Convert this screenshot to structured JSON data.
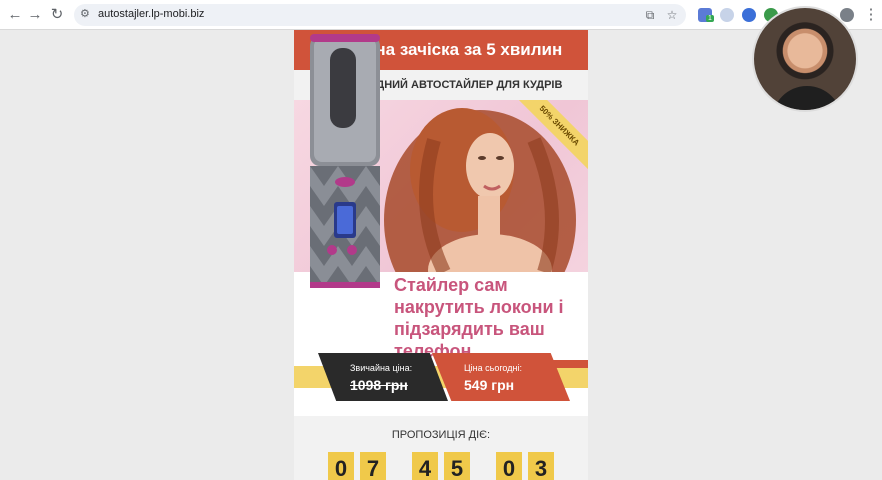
{
  "browser": {
    "url": "autostajler.lp-mobi.biz",
    "back_icon": "back-arrow-icon",
    "forward_icon": "forward-arrow-icon",
    "reload_icon": "reload-icon",
    "ext_badge": "1"
  },
  "landing": {
    "title": "Ідеальна зачіска за 5 хвилин",
    "subtitle": "БЕЗПРОВІДНИЙ АВТОСТАЙЛЕР ДЛЯ КУДРІВ",
    "discount_badge": "50% ЗНИЖКА",
    "headline_1": "Стайлер сам",
    "headline_2": "накрутить локони і",
    "headline_3": "підзарядить ваш",
    "headline_4": "телефон",
    "price_old_label": "Звичайна ціна:",
    "price_old": "1098 грн",
    "price_new_label": "Ціна сьогодні:",
    "price_new": "549 грн",
    "offer_label": "ПРОПОЗИЦІЯ ДІЄ:",
    "timer_digits": [
      "0",
      "7",
      "4",
      "5",
      "0",
      "3"
    ]
  },
  "colors": {
    "accent_red": "#d0533a",
    "pink_text": "#c8557c",
    "timer_yellow": "#f0c94a",
    "strip_yellow": "#f3d46a"
  }
}
